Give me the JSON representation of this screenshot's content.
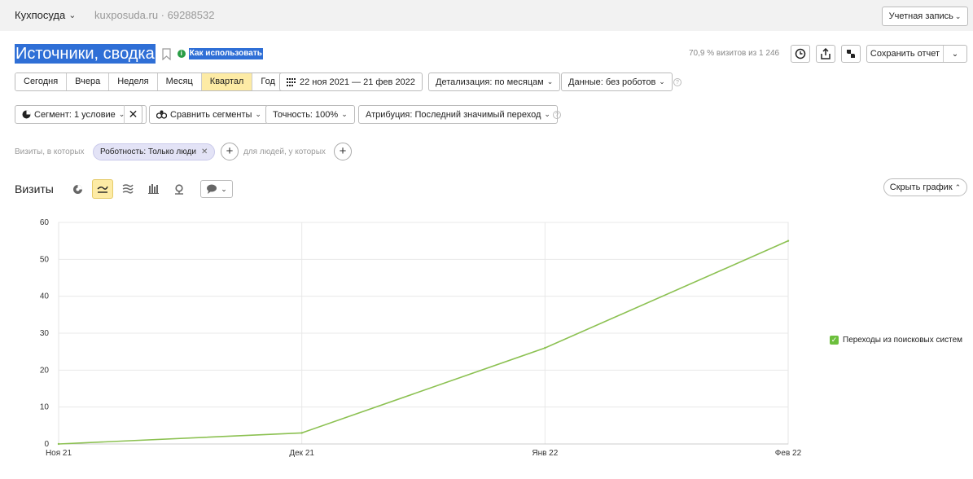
{
  "topbar": {
    "counter_name": "Кухпосуда",
    "counter_site": "kuxposuda.ru · 69288532",
    "account_label": "Учетная запись"
  },
  "header": {
    "title": "Источники, сводка",
    "howto_label": "Как использовать",
    "visits_share": "70,9 % визитов из 1 246",
    "save_label": "Сохранить отчет"
  },
  "periods": {
    "items": [
      "Сегодня",
      "Вчера",
      "Неделя",
      "Месяц",
      "Квартал",
      "Год"
    ],
    "active": "Квартал"
  },
  "toolbar": {
    "date_range": "22 ноя 2021 — 21 фев 2022",
    "detail": "Детализация: по месяцам",
    "data_filter": "Данные: без роботов",
    "segment": "Сегмент: 1 условие",
    "compare": "Сравнить сегменты",
    "accuracy": "Точность: 100%",
    "attribution": "Атрибуция: Последний значимый переход"
  },
  "filters": {
    "visits_label": "Визиты, в которых",
    "chip": "Роботность: Только люди",
    "people_label": "для людей, у которых"
  },
  "chart_section": {
    "title": "Визиты",
    "hide_label": "Скрыть график"
  },
  "colors": {
    "accent": "#fdeba5",
    "series": "#8cc152",
    "legend_box": "#6cbf3c",
    "selection": "#2f6fd6"
  },
  "chart_data": {
    "type": "line",
    "x": [
      "Ноя 21",
      "Дек 21",
      "Янв 22",
      "Фев 22"
    ],
    "series": [
      {
        "name": "Переходы из поисковых систем",
        "values": [
          0,
          3,
          26,
          55
        ]
      }
    ],
    "ylim": [
      0,
      60
    ],
    "yticks": [
      0,
      10,
      20,
      30,
      40,
      50,
      60
    ],
    "grid": true,
    "legend": "right"
  }
}
